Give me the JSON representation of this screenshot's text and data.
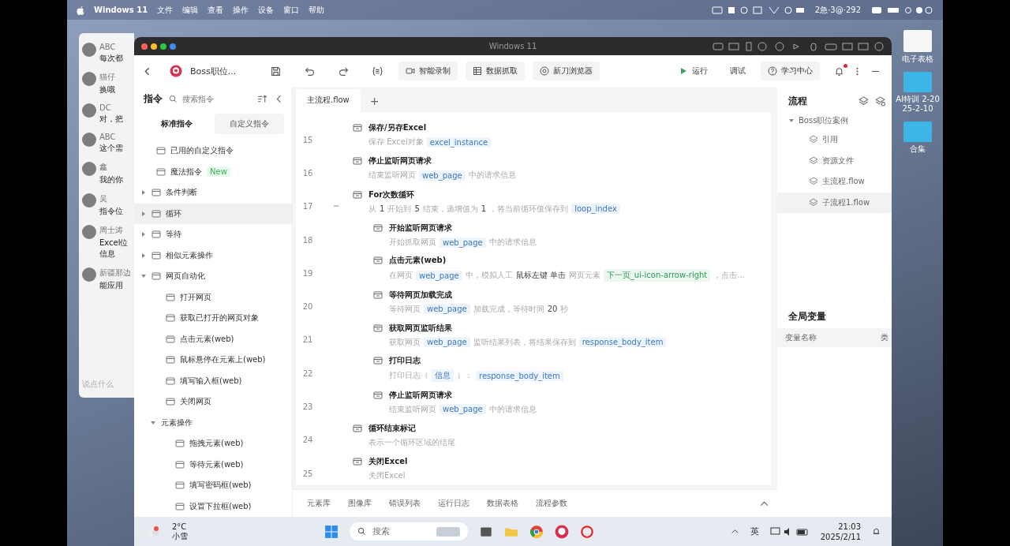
{
  "mac_menu": {
    "items": [
      "Windows 11",
      "文件",
      "编辑",
      "查看",
      "操作",
      "设备",
      "窗口",
      "帮助"
    ],
    "status": "2急·3@·292"
  },
  "chat_window": {
    "messages": [
      {
        "name": "ABC",
        "text": "每次都"
      },
      {
        "name": "猫仔",
        "text": "换哦"
      },
      {
        "name": "DC",
        "text": "对，把"
      },
      {
        "name": "ABC",
        "text": "这个需"
      },
      {
        "name": "鑫",
        "text": "我的你"
      },
      {
        "name": "吴",
        "text": "指令位"
      },
      {
        "name": "周士涛",
        "text": "Excel位信息"
      },
      {
        "name": "新疆那边",
        "text": "能应用"
      }
    ],
    "input_placeholder": "说点什么"
  },
  "desktop_icons": [
    {
      "label": "电子表格"
    },
    {
      "label": "AI特训 2-2025-2-10"
    },
    {
      "label": "合集"
    }
  ],
  "vm_window": {
    "title": "Windows 11"
  },
  "toolbar": {
    "project": "Boss职位...",
    "buttons": [
      {
        "label": "智能录制",
        "kind": "record"
      },
      {
        "label": "数据抓取",
        "kind": "table"
      },
      {
        "label": "新刀浏览器",
        "kind": "browser"
      }
    ],
    "run": "运行",
    "debug": "调试",
    "learn": "学习中心",
    "notification": true
  },
  "commands_panel": {
    "title": "指令",
    "search_placeholder": "搜索指令",
    "tabs": [
      {
        "label": "标准指令",
        "selected": true
      },
      {
        "label": "自定义指令",
        "selected": false
      }
    ],
    "items": [
      {
        "label": "已用的自定义指令",
        "selected": false
      },
      {
        "label": "魔法指令",
        "badge": "New",
        "selected": false
      },
      {
        "label": "条件判断",
        "expanded": false,
        "selected": false
      },
      {
        "label": "循环",
        "expanded": false,
        "selected": true
      },
      {
        "label": "等待",
        "expanded": false,
        "selected": false
      },
      {
        "label": "相似元素操作",
        "expanded": false,
        "selected": false
      },
      {
        "label": "网页自动化",
        "expanded": true,
        "selected": false,
        "children": [
          {
            "label": "打开网页",
            "selected": false
          },
          {
            "label": "获取已打开的网页对象",
            "selected": false
          },
          {
            "label": "点击元素(web)",
            "selected": false
          },
          {
            "label": "鼠标悬停在元素上(web)",
            "selected": false
          },
          {
            "label": "填写输入框(web)",
            "selected": false
          },
          {
            "label": "关闭网页",
            "selected": false
          },
          {
            "label": "元素操作",
            "expanded": true,
            "selected": false,
            "children": [
              {
                "label": "拖拽元素(web)",
                "selected": false
              },
              {
                "label": "等待元素(web)",
                "selected": false
              },
              {
                "label": "填写密码框(web)",
                "selected": false
              },
              {
                "label": "设置下拉框(web)",
                "selected": false
              }
            ]
          }
        ]
      }
    ]
  },
  "editor": {
    "tabs": [
      {
        "label": "主流程.flow",
        "selected": true
      }
    ],
    "add_tab": "+",
    "steps": [
      {
        "line": "15",
        "title": "保存/另存Excel",
        "desc": [
          {
            "kind": "text",
            "text": "保存 Excel对象"
          },
          {
            "kind": "var",
            "text": "excel_instance"
          }
        ]
      },
      {
        "line": "16",
        "title": "停止监听网页请求",
        "desc": [
          {
            "kind": "text",
            "text": "结束监听网页"
          },
          {
            "kind": "var",
            "text": "web_page"
          },
          {
            "kind": "text",
            "text": "中的请求信息"
          }
        ]
      },
      {
        "line": "17",
        "title": "For次数循环",
        "expanded": true,
        "desc": [
          {
            "kind": "text",
            "text": "从"
          },
          {
            "kind": "key",
            "text": "1"
          },
          {
            "kind": "text",
            "text": "开始到"
          },
          {
            "kind": "key",
            "text": "5"
          },
          {
            "kind": "text",
            "text": "结束，递增值为"
          },
          {
            "kind": "key",
            "text": "1"
          },
          {
            "kind": "text",
            "text": "，将当前循环值保存到"
          },
          {
            "kind": "var",
            "text": "loop_index"
          }
        ],
        "children": [
          {
            "line": "18",
            "title": "开始监听网页请求",
            "desc": [
              {
                "kind": "text",
                "text": "开始抓取网页"
              },
              {
                "kind": "var",
                "text": "web_page"
              },
              {
                "kind": "text",
                "text": "中的请求信息"
              }
            ]
          },
          {
            "line": "19",
            "title": "点击元素(web)",
            "desc": [
              {
                "kind": "text",
                "text": "在网页"
              },
              {
                "kind": "var",
                "text": "web_page"
              },
              {
                "kind": "text",
                "text": "中，模拟人工"
              },
              {
                "kind": "key",
                "text": "鼠标左键 单击"
              },
              {
                "kind": "text",
                "text": "网页元素"
              },
              {
                "kind": "element",
                "text": "下一页_ui-icon-arrow-right"
              },
              {
                "kind": "text",
                "text": "，点击..."
              }
            ]
          },
          {
            "line": "20",
            "title": "等待网页加载完成",
            "desc": [
              {
                "kind": "text",
                "text": "等待网页"
              },
              {
                "kind": "var",
                "text": "web_page"
              },
              {
                "kind": "text",
                "text": "加载完成，等待时间"
              },
              {
                "kind": "key",
                "text": "20"
              },
              {
                "kind": "text",
                "text": "秒"
              }
            ]
          },
          {
            "line": "21",
            "title": "获取网页监听结果",
            "desc": [
              {
                "kind": "text",
                "text": "获取网页"
              },
              {
                "kind": "var",
                "text": "web_page"
              },
              {
                "kind": "text",
                "text": "监听结果列表，将结果保存到"
              },
              {
                "kind": "var",
                "text": "response_body_item"
              }
            ]
          },
          {
            "line": "22",
            "title": "打印日志",
            "desc": [
              {
                "kind": "text",
                "text": "打印日志（"
              },
              {
                "kind": "var",
                "text": "信息"
              },
              {
                "kind": "text",
                "text": "）："
              },
              {
                "kind": "var",
                "text": "response_body_item"
              }
            ]
          },
          {
            "line": "23",
            "title": "停止监听网页请求",
            "desc": [
              {
                "kind": "text",
                "text": "结束监听网页"
              },
              {
                "kind": "var",
                "text": "web_page"
              },
              {
                "kind": "text",
                "text": "中的请求信息"
              }
            ]
          }
        ]
      },
      {
        "line": "24",
        "title": "循环结束标记",
        "desc": [
          {
            "kind": "text",
            "text": "表示一个循环区域的结尾"
          }
        ]
      },
      {
        "line": "25",
        "title": "关闭Excel",
        "desc": [
          {
            "kind": "text",
            "text": "关闭Excel"
          }
        ]
      }
    ],
    "bottom_tabs": [
      "元素库",
      "图像库",
      "错误列表",
      "运行日志",
      "数据表格",
      "流程参数"
    ]
  },
  "flow_panel": {
    "title": "流程",
    "project": "Boss职位案例",
    "expanded": true,
    "items": [
      {
        "label": "引用",
        "selected": false
      },
      {
        "label": "资源文件",
        "selected": false
      },
      {
        "label": "主流程.flow",
        "selected": false
      },
      {
        "label": "子流程1.flow",
        "selected": true
      }
    ],
    "variables_title": "全局变量",
    "columns": [
      "变量名称",
      "类"
    ]
  },
  "taskbar": {
    "temperature": "2°C",
    "weather": "小雪",
    "search_placeholder": "搜索",
    "input_method": "英",
    "time": "21:03",
    "date": "2025/2/11"
  }
}
